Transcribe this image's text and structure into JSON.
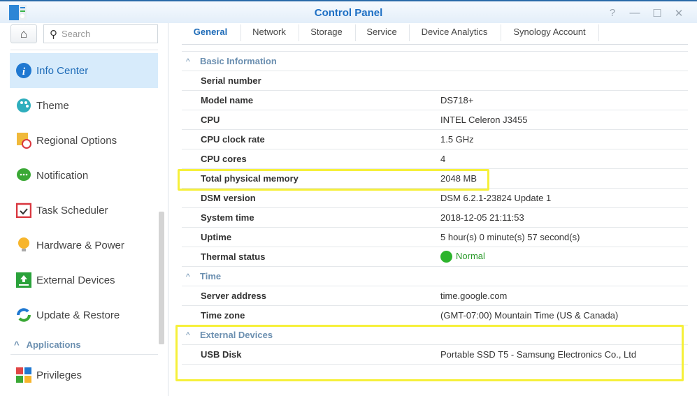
{
  "window": {
    "title": "Control Panel",
    "help": "?",
    "minimize": "—",
    "maximize": "☐",
    "close": "✕"
  },
  "sidebar": {
    "search_placeholder": "Search",
    "items": [
      {
        "label": "Info Center",
        "icon": "info-icon",
        "active": true
      },
      {
        "label": "Theme",
        "icon": "palette-icon"
      },
      {
        "label": "Regional Options",
        "icon": "map-clock-icon"
      },
      {
        "label": "Notification",
        "icon": "chat-bubble-icon"
      },
      {
        "label": "Task Scheduler",
        "icon": "calendar-check-icon"
      },
      {
        "label": "Hardware & Power",
        "icon": "lightbulb-icon"
      },
      {
        "label": "External Devices",
        "icon": "upload-icon"
      },
      {
        "label": "Update & Restore",
        "icon": "refresh-icon"
      }
    ],
    "section": "Applications",
    "section_items": [
      {
        "label": "Privileges",
        "icon": "privileges-icon"
      }
    ]
  },
  "tabs": [
    "General",
    "Network",
    "Storage",
    "Service",
    "Device Analytics",
    "Synology Account"
  ],
  "active_tab": "General",
  "sections": [
    {
      "title": "Basic Information",
      "rows": [
        {
          "label": "Serial number",
          "value": ""
        },
        {
          "label": "Model name",
          "value": "DS718+"
        },
        {
          "label": "CPU",
          "value": "INTEL Celeron J3455"
        },
        {
          "label": "CPU clock rate",
          "value": "1.5 GHz"
        },
        {
          "label": "CPU cores",
          "value": "4"
        },
        {
          "label": "Total physical memory",
          "value": "2048 MB"
        },
        {
          "label": "DSM version",
          "value": "DSM 6.2.1-23824 Update 1"
        },
        {
          "label": "System time",
          "value": "2018-12-05 21:11:53"
        },
        {
          "label": "Uptime",
          "value": "5 hour(s) 0 minute(s) 57 second(s)"
        },
        {
          "label": "Thermal status",
          "value": "Normal",
          "status_color": "#2db42d"
        }
      ]
    },
    {
      "title": "Time",
      "rows": [
        {
          "label": "Server address",
          "value": "time.google.com"
        },
        {
          "label": "Time zone",
          "value": "(GMT-07:00) Mountain Time (US & Canada)"
        }
      ]
    },
    {
      "title": "External Devices",
      "rows": [
        {
          "label": "USB Disk",
          "value": "Portable SSD T5 - Samsung Electronics Co., Ltd"
        }
      ]
    }
  ],
  "colors": {
    "accent": "#1f6cb8",
    "highlight": "#f6f03a"
  }
}
